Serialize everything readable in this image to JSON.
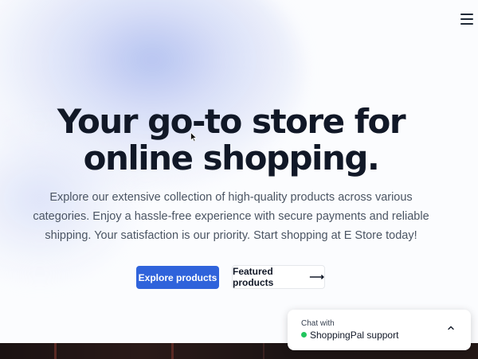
{
  "nav": {
    "menu_icon": "hamburger-menu-icon"
  },
  "hero": {
    "title_line1": "Your go-to store for",
    "title_line2": "online shopping.",
    "description": "Explore our extensive collection of high-quality products across various categories. Enjoy a hassle-free experience with secure payments and reliable shipping. Your satisfaction is our priority. Start shopping at E Store today!",
    "primary_button": "Explore products",
    "secondary_button": "Featured products",
    "secondary_arrow": "⟶"
  },
  "chat_widget": {
    "label": "Chat with",
    "name": "ShoppingPal support",
    "status_color": "#22c55e",
    "toggle_icon": "chevron-up-icon"
  },
  "colors": {
    "accent": "#2f63db",
    "text": "#111827"
  }
}
